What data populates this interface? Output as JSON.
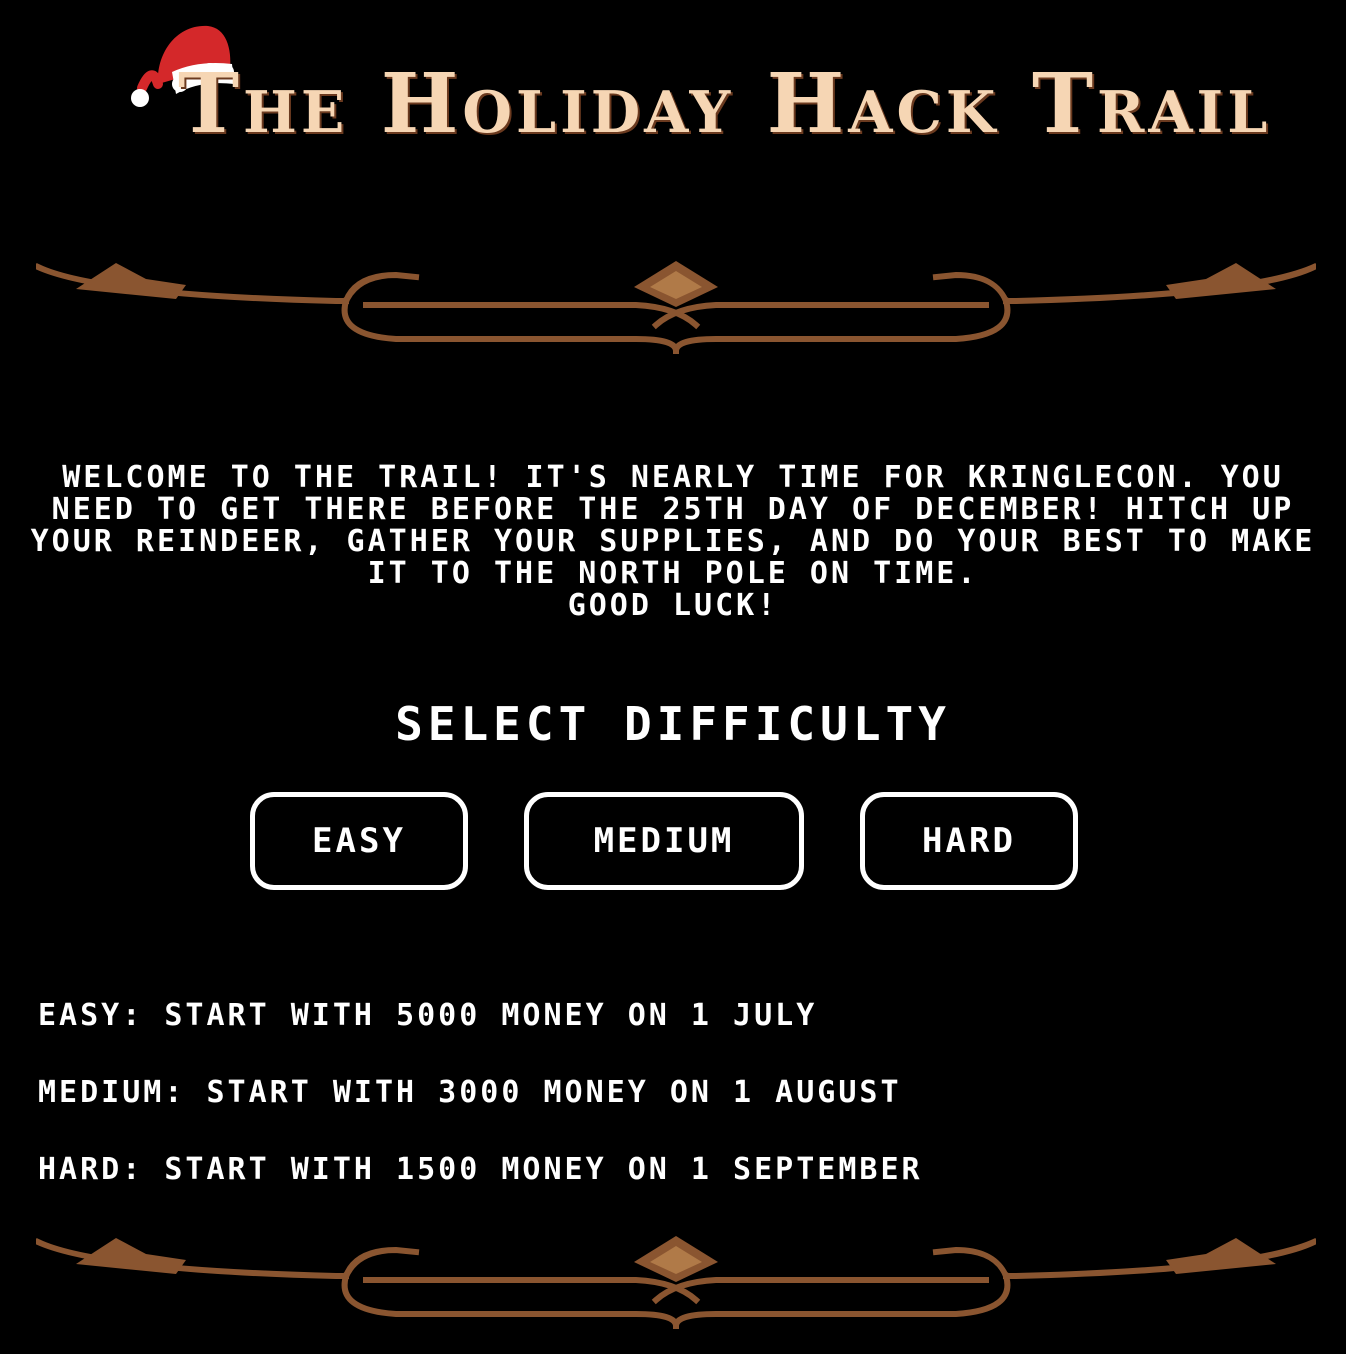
{
  "title": "The Holiday Hack Trail",
  "intro": {
    "line1": "WELCOME TO THE TRAIL! IT'S NEARLY TIME FOR KRINGLECON. YOU NEED TO GET THERE BEFORE THE 25TH DAY OF DECEMBER! HITCH UP YOUR REINDEER, GATHER YOUR SUPPLIES, AND DO YOUR BEST TO MAKE IT TO THE NORTH POLE ON TIME.",
    "line2": "GOOD LUCK!"
  },
  "select_heading": "SELECT DIFFICULTY",
  "buttons": {
    "easy": "EASY",
    "medium": "MEDIUM",
    "hard": "HARD"
  },
  "difficulty_info": {
    "easy": "EASY: START WITH 5000 MONEY ON 1 JULY",
    "medium": "MEDIUM: START WITH 3000 MONEY ON 1 AUGUST",
    "hard": "HARD: START WITH 1500 MONEY ON 1 SEPTEMBER"
  },
  "colors": {
    "background": "#000000",
    "text": "#ffffff",
    "title": "#f6d6b4",
    "ornament": "#8a5530",
    "ornament_light": "#b07a48",
    "hat_red": "#d4282a",
    "hat_white": "#ffffff"
  },
  "icons": {
    "hat": "santa-hat-icon",
    "divider": "ornamental-divider"
  }
}
